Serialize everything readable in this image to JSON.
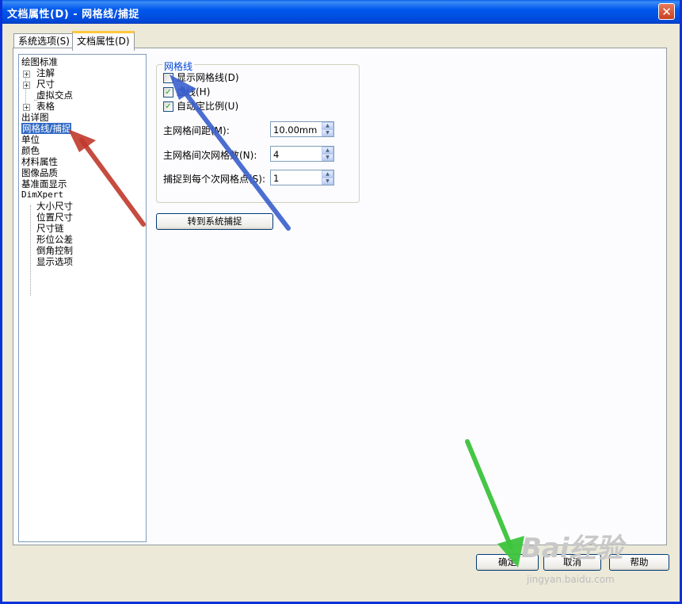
{
  "window": {
    "title": "文档属性(D) - 网格线/捕捉"
  },
  "tabs": [
    {
      "label": "系统选项(S)",
      "active": false
    },
    {
      "label": "文档属性(D)",
      "active": true
    }
  ],
  "tree": {
    "items": [
      {
        "label": "绘图标准"
      },
      {
        "label": "注解"
      },
      {
        "label": "尺寸"
      },
      {
        "label": "虚拟交点"
      },
      {
        "label": "表格"
      },
      {
        "label": "出详图"
      },
      {
        "label": "网格线/捕捉",
        "selected": true
      },
      {
        "label": "单位"
      },
      {
        "label": "颜色"
      },
      {
        "label": "材料属性"
      },
      {
        "label": "图像品质"
      },
      {
        "label": "基准面显示"
      },
      {
        "label": "DimXpert"
      },
      {
        "label": "大小尺寸"
      },
      {
        "label": "位置尺寸"
      },
      {
        "label": "尺寸链"
      },
      {
        "label": "形位公差"
      },
      {
        "label": "倒角控制"
      },
      {
        "label": "显示选项"
      }
    ]
  },
  "grid_group": {
    "legend": "网格线",
    "show_grid": {
      "label": "显示网格线(D)",
      "checked": false
    },
    "dashed": {
      "label": "虚线(H)",
      "checked": true
    },
    "auto_scale": {
      "label": "自动定比例(U)",
      "checked": true
    },
    "major_spacing": {
      "label": "主网格间距(M):",
      "value": "10.00mm"
    },
    "minor_lines": {
      "label": "主网格间次网格数(N):",
      "value": "4"
    },
    "snap_points": {
      "label": "捕捉到每个次网格点(S):",
      "value": "1"
    }
  },
  "goto_snap_button": "转到系统捕捉",
  "footer": {
    "ok": "确定",
    "cancel": "取消",
    "help": "帮助"
  },
  "watermark": {
    "brand": "Bai经验",
    "url": "jingyan.baidu.com"
  },
  "colors": {
    "titlebar": "#0058ee",
    "selection": "#316ac5",
    "arrow_red": "#c0392b",
    "arrow_blue": "#3a5fcd",
    "arrow_green": "#3cc43c"
  }
}
